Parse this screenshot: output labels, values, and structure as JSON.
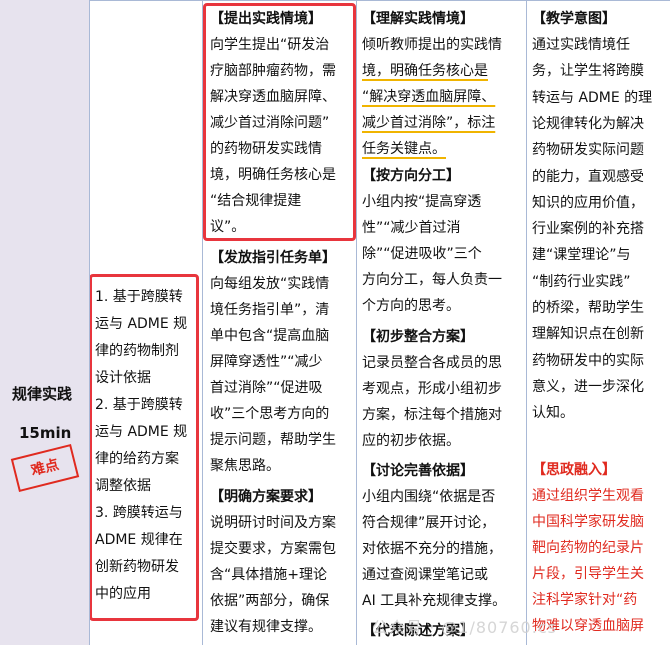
{
  "left_label": {
    "title": "规律实践",
    "duration": "15min",
    "stamp": "难点"
  },
  "content_list": [
    "1. 基于跨膜转",
    "运与 ADME 规",
    "律的药物制剂",
    "设计依据",
    "2. 基于跨膜转",
    "运与 ADME 规",
    "律的给药方案",
    "调整依据",
    "3. 跨膜转运与",
    "ADME 规律在",
    "创新药物研发",
    "中的应用"
  ],
  "teacher": {
    "s1_head": "【提出实践情境】",
    "s1_lines": [
      "向学生提出“研发治",
      "疗脑部肿瘤药物，需",
      "解决穿透血脑屏障、",
      "减少首过消除问题”",
      "的药物研发实践情",
      "境，明确任务核心是",
      "“结合规律提建",
      "议”。"
    ],
    "s2_head": "【发放指引任务单】",
    "s2_lines": [
      "向每组发放“实践情",
      "境任务指引单”，清",
      "单中包含“提高血脑",
      "屏障穿透性”“减少",
      "首过消除”“促进吸",
      "收”三个思考方向的",
      "提示问题，帮助学生",
      "聚焦思路。"
    ],
    "s3_head": "【明确方案要求】",
    "s3_lines": [
      "说明研讨时间及方案",
      "提交要求，方案需包",
      "含“具体措施+理论",
      "依据”两部分，确保",
      "建议有规律支撑。"
    ]
  },
  "student": {
    "s1_head": "【理解实践情境】",
    "s1_lines": [
      "倾听教师提出的实践情",
      "境，明确任务核心是",
      "“解决穿透血脑屏障、",
      "减少首过消除”，标注",
      "任务关键点。"
    ],
    "s2_head": "【按方向分工】",
    "s2_lines": [
      "小组内按“提高穿透",
      "性”“减少首过消",
      "除”“促进吸收”三个",
      "方向分工，每人负责一",
      "个方向的思考。"
    ],
    "s3_head": "【初步整合方案】",
    "s3_lines": [
      "记录员整合各成员的思",
      "考观点，形成小组初步",
      "方案，标注每个措施对",
      "应的初步依据。"
    ],
    "s4_head": "【讨论完善依据】",
    "s4_lines": [
      "小组内围绕“依据是否",
      "符合规律”展开讨论，",
      "对依据不充分的措施，",
      "通过查阅课堂笔记或",
      "AI 工具补充规律支撑。"
    ],
    "s5_head": "【代表陈述方案】"
  },
  "intent": {
    "s1_head": "【教学意图】",
    "s1_lines": [
      "通过实践情境任",
      "务，让学生将跨膜",
      "转运与 ADME 的理",
      "论规律转化为解决",
      "药物研发实际问题",
      "的能力，直观感受",
      "知识的应用价值，",
      "行业案例的补充搭",
      "建“课堂理论”与",
      "“制药行业实践”",
      "的桥梁，帮助学生",
      "理解知识点在创新",
      "药物研发中的实际",
      "意义，进一步深化",
      "认知。"
    ],
    "s2_head": "【思政融入】",
    "s2_lines": [
      "通过组织学生观看",
      "中国科学家研发脑",
      "靶向药物的纪录片",
      "片段，引导学生关",
      "注科学家针对“药",
      "物难以穿透血脑屏"
    ]
  },
  "watermark": "公众号 · @1/80760.cs",
  "colors": {
    "stamp_red": "#e02a1f",
    "box_red": "#e8353d",
    "underline": "#f0b400",
    "left_bg": "#e7e3ee",
    "grid": "#a9b9d6"
  }
}
